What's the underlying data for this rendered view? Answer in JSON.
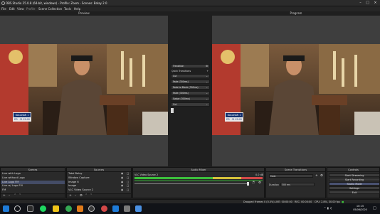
{
  "window": {
    "title": "OBS Studio 25.0.8 (64-bit, windows) - Profile: Zoom - Scenes: Balay 2.0"
  },
  "menu": [
    "File",
    "Edit",
    "View",
    "Profile",
    "Scene Collection",
    "Tools",
    "Help"
  ],
  "panes": {
    "preview_label": "Preview",
    "program_label": "Program"
  },
  "lower_third": {
    "name": "BACANAN 1",
    "sub": "ED · 01:29:00"
  },
  "transitions_column": {
    "header": "Transition",
    "quick_label": "Quick Transitions",
    "items": [
      "Cut",
      "Fade (300ms)",
      "Fade to Black (300ms)",
      "Fade (300ms)",
      "Swipe (300ms)",
      "Cut"
    ]
  },
  "scenes": {
    "title": "Scenes",
    "items": [
      "Live with Logo",
      "Live without Logo",
      "Live Logo FM",
      "Live w/ Logo FM",
      "FM"
    ],
    "selected_index": 2
  },
  "sources": {
    "title": "Sources",
    "items": [
      "Tatai Balay",
      "Window Capture",
      "Image 6",
      "Image",
      "VLC Video Source 2"
    ]
  },
  "mixer": {
    "title": "Audio Mixer",
    "channel_name": "VLC Video Source 2",
    "channel_db": "0.0 dB"
  },
  "scene_transitions": {
    "title": "Scene Transitions",
    "selected": "Fade",
    "duration_label": "Duration",
    "duration_value": "300 ms"
  },
  "controls": {
    "title": "Controls",
    "buttons": [
      "Start Streaming",
      "Start Recording",
      "Studio Mode",
      "Settings",
      "Exit"
    ]
  },
  "status": {
    "dropped": "Dropped Frames 0 (0.0%)",
    "live": "LIVE: 00:00:00",
    "rec": "REC: 00:00:00",
    "cpu": "CPU: 2.8%, 30.00 fps"
  },
  "taskbar": {
    "time": "10:15",
    "date": "05/06/2020"
  },
  "colors": {
    "accent": "#1e7bd8",
    "meter_green": "#3cc03c",
    "meter_yellow": "#d6c23a",
    "meter_red": "#d24848",
    "selected_row": "#444c66"
  }
}
